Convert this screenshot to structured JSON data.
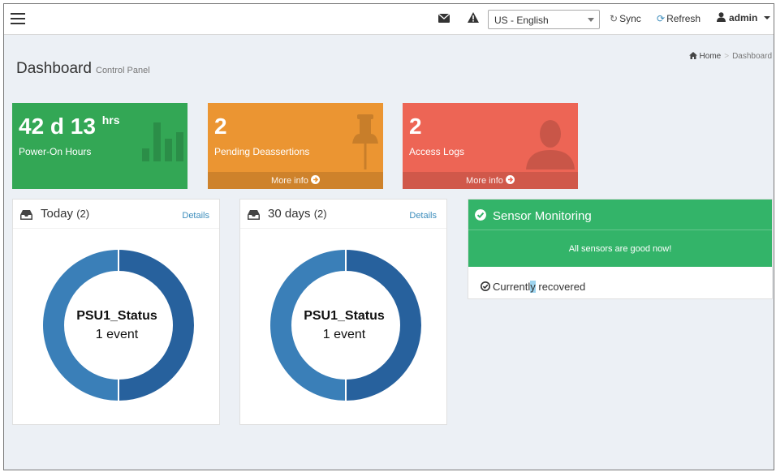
{
  "navbar": {
    "menu_icon": "hamburger-menu-icon",
    "mail_icon": "envelope-icon",
    "alert_icon": "warning-icon",
    "language": "US - English",
    "sync_label": "Sync",
    "refresh_label": "Refresh",
    "user_label": "admin"
  },
  "page": {
    "title": "Dashboard",
    "subtitle": "Control Panel"
  },
  "breadcrumb": {
    "home": "Home",
    "separator": ">",
    "current": "Dashboard"
  },
  "stats": {
    "power": {
      "value": "42 d 13",
      "unit": "hrs",
      "label": "Power-On Hours",
      "color": "#33a755"
    },
    "deassertions": {
      "value": "2",
      "label": "Pending Deassertions",
      "footer": "More info",
      "color": "#eb9532"
    },
    "logs": {
      "value": "2",
      "label": "Access Logs",
      "footer": "More info",
      "color": "#ed6555"
    }
  },
  "panels": {
    "today": {
      "title": "Today",
      "count": "(2)",
      "details": "Details",
      "sensor": "PSU1_Status",
      "events": "1 event"
    },
    "thirty_days": {
      "title": "30 days",
      "count": "(2)",
      "details": "Details",
      "sensor": "PSU1_Status",
      "events": "1 event"
    }
  },
  "donut_colors": {
    "left": "#3a7fb8",
    "right": "#27619d"
  },
  "sensor_monitoring": {
    "title": "Sensor Monitoring",
    "message": "All sensors are good now!",
    "status_before": "Current",
    "status_highlight": "l",
    "status_mid": "y",
    "status_after": " recovered",
    "color": "#33b469"
  }
}
